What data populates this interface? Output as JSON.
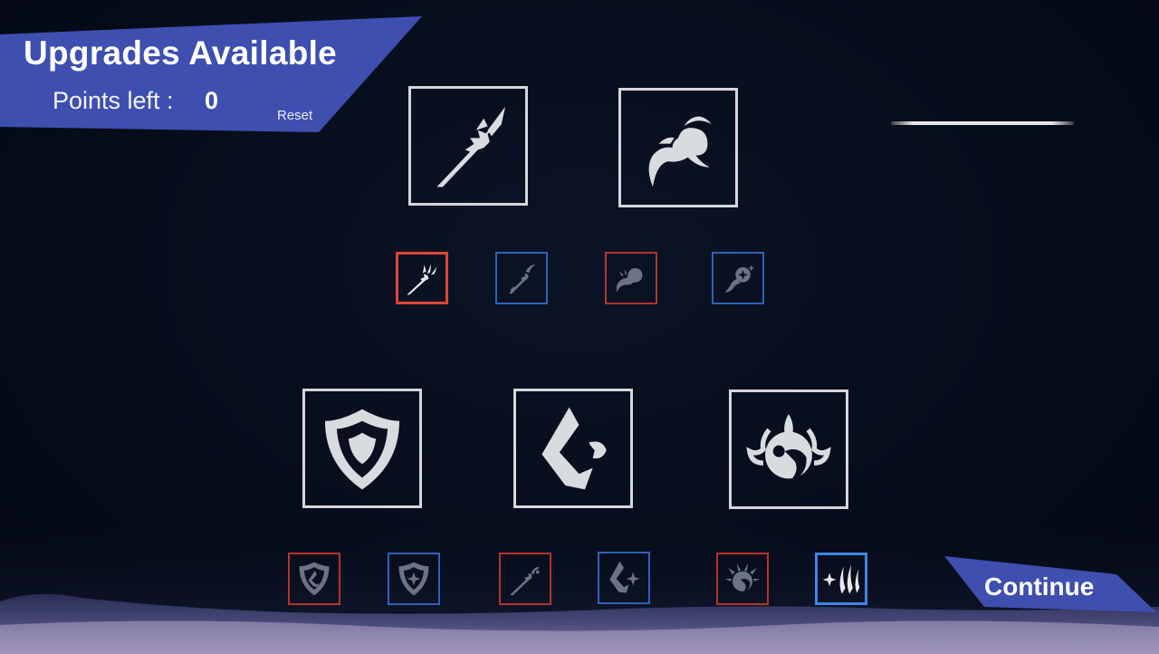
{
  "header": {
    "title": "Upgrades Available",
    "points_label": "Points left :",
    "points_value": "0",
    "reset_label": "Reset"
  },
  "continue_label": "Continue",
  "colors": {
    "banner": "#3e4fb0",
    "slot_border": "#d4d7dc",
    "red_border": "#b3342d",
    "blue_border": "#2f63b7"
  },
  "abilities": [
    {
      "icon": "feathered-arrow-icon"
    },
    {
      "icon": "rising-spirit-icon"
    },
    {
      "icon": "shield-icon"
    },
    {
      "icon": "claw-c-icon"
    },
    {
      "icon": "eclipse-burst-icon"
    }
  ],
  "upgrades": [
    {
      "icon": "arrow-triple-feather-icon",
      "color": "red",
      "selected": true
    },
    {
      "icon": "arrow-hook-icon",
      "color": "blue",
      "selected": false
    },
    {
      "icon": "spirit-fist-icon",
      "color": "red",
      "selected": false
    },
    {
      "icon": "spirit-orb-star-icon",
      "color": "blue",
      "selected": false
    },
    {
      "icon": "shield-claw-icon",
      "color": "red",
      "selected": false
    },
    {
      "icon": "shield-star-icon",
      "color": "blue",
      "selected": false
    },
    {
      "icon": "arrow-claw-icon",
      "color": "red",
      "selected": false
    },
    {
      "icon": "claw-star-icon",
      "color": "blue",
      "selected": false
    },
    {
      "icon": "burst-wave-icon",
      "color": "red",
      "selected": false
    },
    {
      "icon": "sparkle-slashes-icon",
      "color": "blue",
      "selected": true
    }
  ]
}
